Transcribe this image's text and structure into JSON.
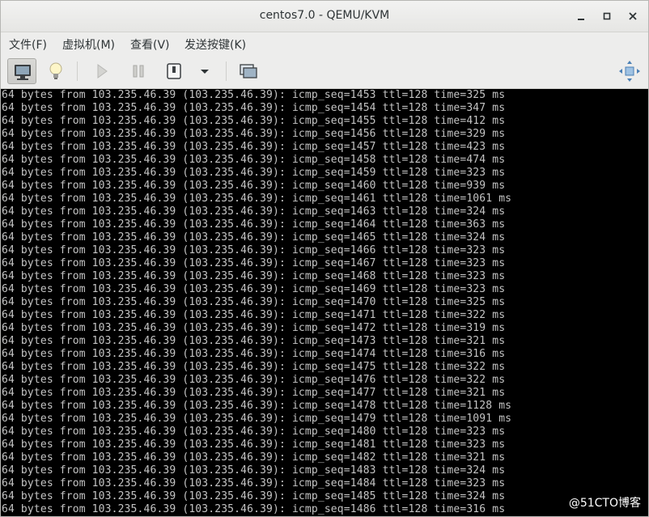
{
  "window": {
    "title": "centos7.0 - QEMU/KVM",
    "minimize": "–",
    "maximize": "□",
    "close": "✕"
  },
  "menu": {
    "items": [
      {
        "label": "文件(F)"
      },
      {
        "label": "虚拟机(M)"
      },
      {
        "label": "查看(V)"
      },
      {
        "label": "发送按键(K)"
      }
    ]
  },
  "toolbar": {
    "icons": [
      "monitor-icon",
      "lightbulb-icon",
      "play-icon",
      "pause-icon",
      "power-icon",
      "dropdown-arrow-icon",
      "screenshot-icon",
      "fullscreen-icon"
    ]
  },
  "console": {
    "lines": [
      "64 bytes from 103.235.46.39 (103.235.46.39): icmp_seq=1453 ttl=128 time=325 ms",
      "64 bytes from 103.235.46.39 (103.235.46.39): icmp_seq=1454 ttl=128 time=347 ms",
      "64 bytes from 103.235.46.39 (103.235.46.39): icmp_seq=1455 ttl=128 time=412 ms",
      "64 bytes from 103.235.46.39 (103.235.46.39): icmp_seq=1456 ttl=128 time=329 ms",
      "64 bytes from 103.235.46.39 (103.235.46.39): icmp_seq=1457 ttl=128 time=423 ms",
      "64 bytes from 103.235.46.39 (103.235.46.39): icmp_seq=1458 ttl=128 time=474 ms",
      "64 bytes from 103.235.46.39 (103.235.46.39): icmp_seq=1459 ttl=128 time=323 ms",
      "64 bytes from 103.235.46.39 (103.235.46.39): icmp_seq=1460 ttl=128 time=939 ms",
      "64 bytes from 103.235.46.39 (103.235.46.39): icmp_seq=1461 ttl=128 time=1061 ms",
      "64 bytes from 103.235.46.39 (103.235.46.39): icmp_seq=1463 ttl=128 time=324 ms",
      "64 bytes from 103.235.46.39 (103.235.46.39): icmp_seq=1464 ttl=128 time=363 ms",
      "64 bytes from 103.235.46.39 (103.235.46.39): icmp_seq=1465 ttl=128 time=324 ms",
      "64 bytes from 103.235.46.39 (103.235.46.39): icmp_seq=1466 ttl=128 time=323 ms",
      "64 bytes from 103.235.46.39 (103.235.46.39): icmp_seq=1467 ttl=128 time=323 ms",
      "64 bytes from 103.235.46.39 (103.235.46.39): icmp_seq=1468 ttl=128 time=323 ms",
      "64 bytes from 103.235.46.39 (103.235.46.39): icmp_seq=1469 ttl=128 time=323 ms",
      "64 bytes from 103.235.46.39 (103.235.46.39): icmp_seq=1470 ttl=128 time=325 ms",
      "64 bytes from 103.235.46.39 (103.235.46.39): icmp_seq=1471 ttl=128 time=322 ms",
      "64 bytes from 103.235.46.39 (103.235.46.39): icmp_seq=1472 ttl=128 time=319 ms",
      "64 bytes from 103.235.46.39 (103.235.46.39): icmp_seq=1473 ttl=128 time=321 ms",
      "64 bytes from 103.235.46.39 (103.235.46.39): icmp_seq=1474 ttl=128 time=316 ms",
      "64 bytes from 103.235.46.39 (103.235.46.39): icmp_seq=1475 ttl=128 time=322 ms",
      "64 bytes from 103.235.46.39 (103.235.46.39): icmp_seq=1476 ttl=128 time=322 ms",
      "64 bytes from 103.235.46.39 (103.235.46.39): icmp_seq=1477 ttl=128 time=321 ms",
      "64 bytes from 103.235.46.39 (103.235.46.39): icmp_seq=1478 ttl=128 time=1128 ms",
      "64 bytes from 103.235.46.39 (103.235.46.39): icmp_seq=1479 ttl=128 time=1091 ms",
      "64 bytes from 103.235.46.39 (103.235.46.39): icmp_seq=1480 ttl=128 time=323 ms",
      "64 bytes from 103.235.46.39 (103.235.46.39): icmp_seq=1481 ttl=128 time=323 ms",
      "64 bytes from 103.235.46.39 (103.235.46.39): icmp_seq=1482 ttl=128 time=321 ms",
      "64 bytes from 103.235.46.39 (103.235.46.39): icmp_seq=1483 ttl=128 time=324 ms",
      "64 bytes from 103.235.46.39 (103.235.46.39): icmp_seq=1484 ttl=128 time=323 ms",
      "64 bytes from 103.235.46.39 (103.235.46.39): icmp_seq=1485 ttl=128 time=324 ms",
      "64 bytes from 103.235.46.39 (103.235.46.39): icmp_seq=1486 ttl=128 time=316 ms"
    ]
  },
  "watermark": "@51CTO博客"
}
